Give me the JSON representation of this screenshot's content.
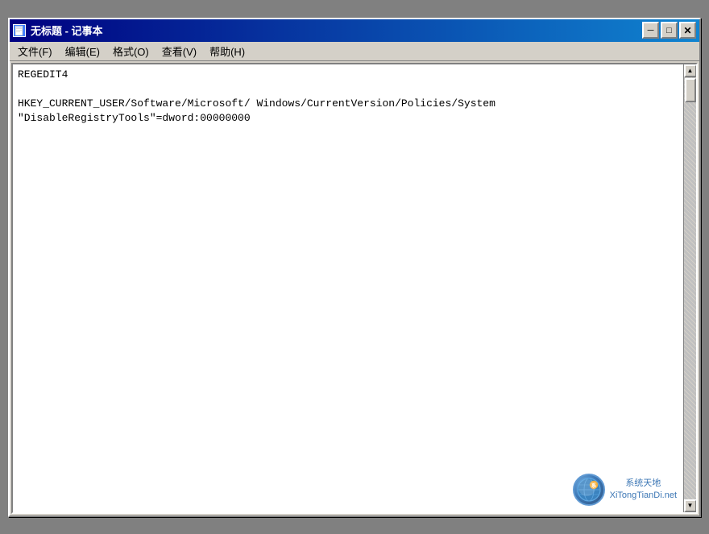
{
  "window": {
    "title": "无标题 - 记事本",
    "icon_label": "notepad-icon"
  },
  "title_buttons": {
    "minimize": "─",
    "maximize": "□",
    "close": "✕"
  },
  "menu": {
    "items": [
      {
        "label": "文件(F)",
        "key": "file"
      },
      {
        "label": "编辑(E)",
        "key": "edit"
      },
      {
        "label": "格式(O)",
        "key": "format"
      },
      {
        "label": "查看(V)",
        "key": "view"
      },
      {
        "label": "帮助(H)",
        "key": "help"
      }
    ]
  },
  "editor": {
    "content": "REGEDIT4\n\nHKEY_CURRENT_USER/Software/Microsoft/ Windows/CurrentVersion/Policies/System\n\"DisableRegistryTools\"=dword:00000000"
  },
  "watermark": {
    "site_line1": "系统天地",
    "site_line2": "XiTongTianDi.net"
  }
}
